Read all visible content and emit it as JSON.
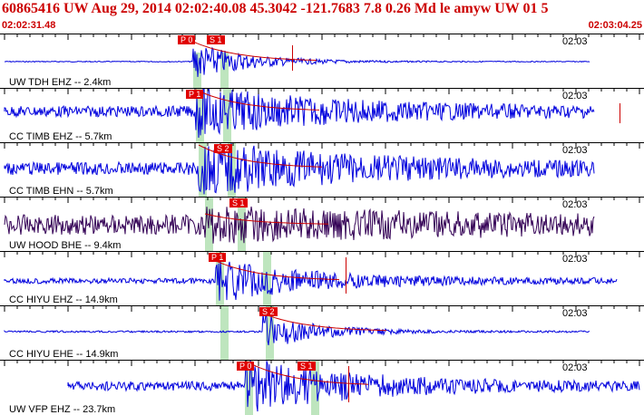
{
  "header": {
    "event_line": "60865416 UW Aug 29, 2014 02:02:40.08   45.3042 -121.7683  7.8 0.26 Md le amyw UW 01   5",
    "start_time": "02:02:31.48",
    "end_time": "02:03:04.25"
  },
  "colors": {
    "trace": "#0000dd",
    "trace_hood": "#330055",
    "pick": "#e00000",
    "band": "#a8dca8"
  },
  "panels": [
    {
      "label": "UW TDH EHZ -- 2.4km",
      "clock": "02:03",
      "picks": [
        "P 0",
        "S 1"
      ]
    },
    {
      "label": "CC TIMB EHZ -- 5.7km",
      "clock": "02:03",
      "picks": [
        "P 1"
      ]
    },
    {
      "label": "CC TIMB EHN -- 5.7km",
      "clock": "02:03",
      "picks": [
        "S 2"
      ]
    },
    {
      "label": "UW HOOD BHE -- 9.4km",
      "clock": "02:03",
      "picks": [
        "S 1"
      ]
    },
    {
      "label": "CC HIYU EHZ -- 14.9km",
      "clock": "02:03",
      "picks": [
        "P 1"
      ]
    },
    {
      "label": "CC HIYU EHE -- 14.9km",
      "clock": "02:03",
      "picks": [
        "S 2"
      ]
    },
    {
      "label": "UW VFP EHZ -- 23.7km",
      "clock": "02:03",
      "picks": [
        "P 0",
        "S 1"
      ]
    }
  ]
}
